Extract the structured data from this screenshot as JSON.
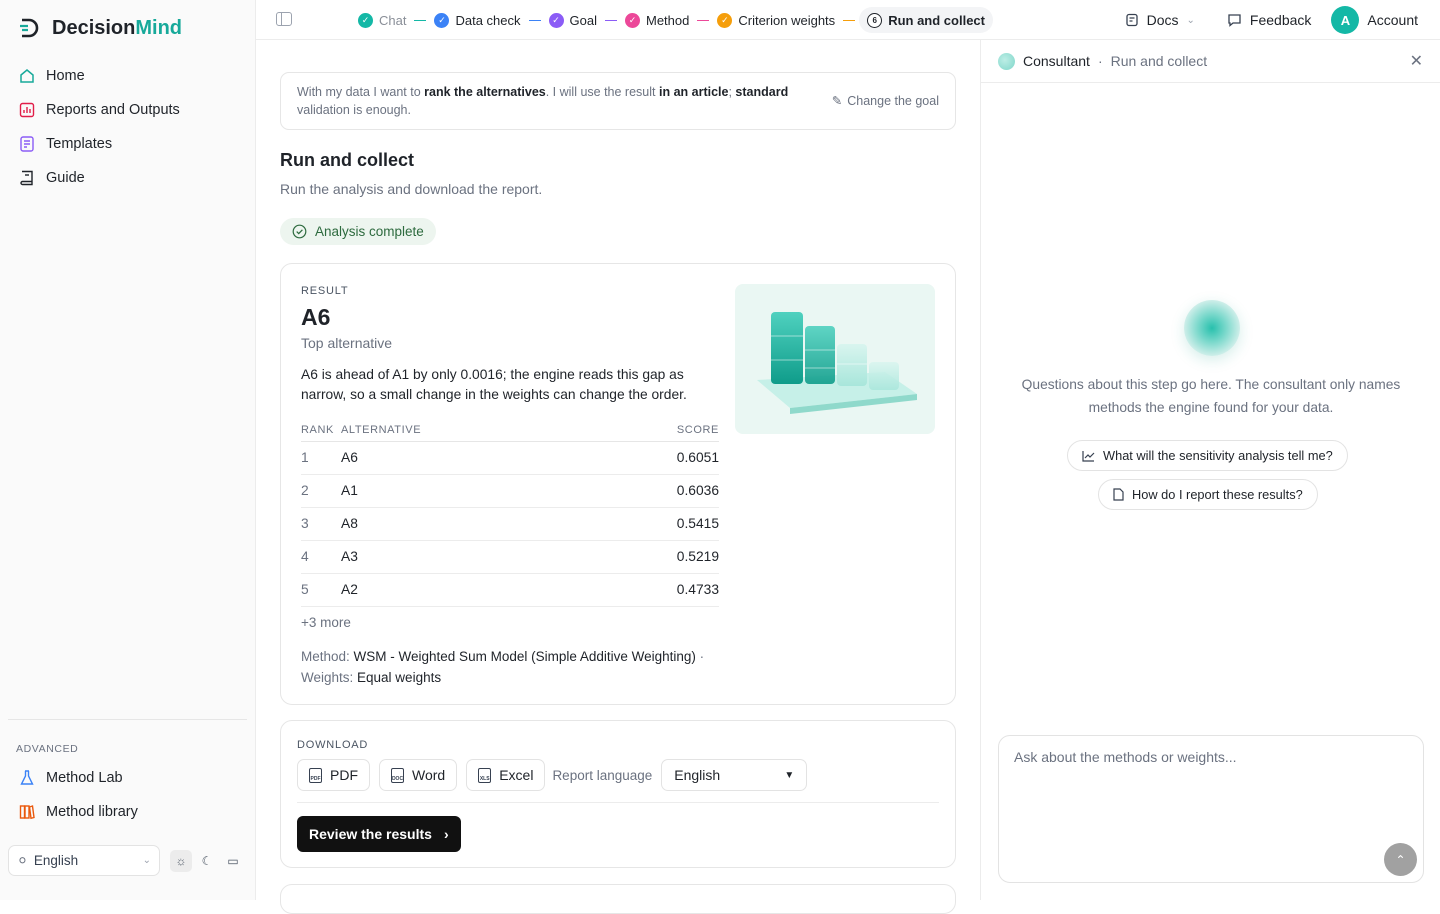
{
  "brand": {
    "part1": "Decision",
    "part2": "Mind"
  },
  "nav": [
    {
      "label": "Home",
      "icon": "home-icon"
    },
    {
      "label": "Reports and Outputs",
      "icon": "reports-icon"
    },
    {
      "label": "Templates",
      "icon": "templates-icon"
    },
    {
      "label": "Guide",
      "icon": "book-icon"
    }
  ],
  "advanced": {
    "title": "ADVANCED",
    "items": [
      {
        "label": "Method Lab",
        "icon": "flask-icon"
      },
      {
        "label": "Method library",
        "icon": "library-icon"
      }
    ]
  },
  "side_language": "English",
  "steps": [
    {
      "label": "Chat",
      "color": "#14b8a6",
      "state": "done-muted"
    },
    {
      "label": "Data check",
      "color": "#3b82f6",
      "state": "done"
    },
    {
      "label": "Goal",
      "color": "#8b5cf6",
      "state": "done"
    },
    {
      "label": "Method",
      "color": "#ec4899",
      "state": "done"
    },
    {
      "label": "Criterion weights",
      "color": "#f59e0b",
      "state": "done"
    },
    {
      "label": "Run and collect",
      "number": "6",
      "state": "current"
    }
  ],
  "topbar": {
    "docs": "Docs",
    "feedback": "Feedback",
    "avatar_letter": "A",
    "account": "Account"
  },
  "goal": {
    "p1": "With my data I want to ",
    "b1": "rank the alternatives",
    "p2": ". I will use the result ",
    "b2": "in an article",
    "p3": "; ",
    "b3": "standard",
    "p4": " validation is enough.",
    "change": "Change the goal"
  },
  "page": {
    "title": "Run and collect",
    "subtitle": "Run the analysis and download the report.",
    "status": "Analysis complete"
  },
  "result": {
    "label": "RESULT",
    "name": "A6",
    "top": "Top alternative",
    "desc": "A6 is ahead of A1 by only 0.0016; the engine reads this gap as narrow, so a small change in the weights can change the order.",
    "cols": {
      "rank": "RANK",
      "alt": "ALTERNATIVE",
      "score": "SCORE"
    },
    "rows": [
      {
        "rank": "1",
        "alt": "A6",
        "score": "0.6051"
      },
      {
        "rank": "2",
        "alt": "A1",
        "score": "0.6036"
      },
      {
        "rank": "3",
        "alt": "A8",
        "score": "0.5415"
      },
      {
        "rank": "4",
        "alt": "A3",
        "score": "0.5219"
      },
      {
        "rank": "5",
        "alt": "A2",
        "score": "0.4733"
      }
    ],
    "more": "+3 more",
    "method_k": "Method: ",
    "method_v": "WSM - Weighted Sum Model (Simple Additive Weighting)",
    "weights_k": "Weights: ",
    "weights_v": "Equal weights"
  },
  "download": {
    "title": "DOWNLOAD",
    "pdf": "PDF",
    "word": "Word",
    "excel": "Excel",
    "report_lang_label": "Report language",
    "report_lang": "English",
    "review": "Review the results"
  },
  "panel": {
    "title": "Consultant",
    "context": "Run and collect",
    "intro": "Questions about this step go here. The consultant only names methods the engine found for your data.",
    "chip1": "What will the sensitivity analysis tell me?",
    "chip2": "How do I report these results?",
    "placeholder": "Ask about the methods or weights..."
  }
}
